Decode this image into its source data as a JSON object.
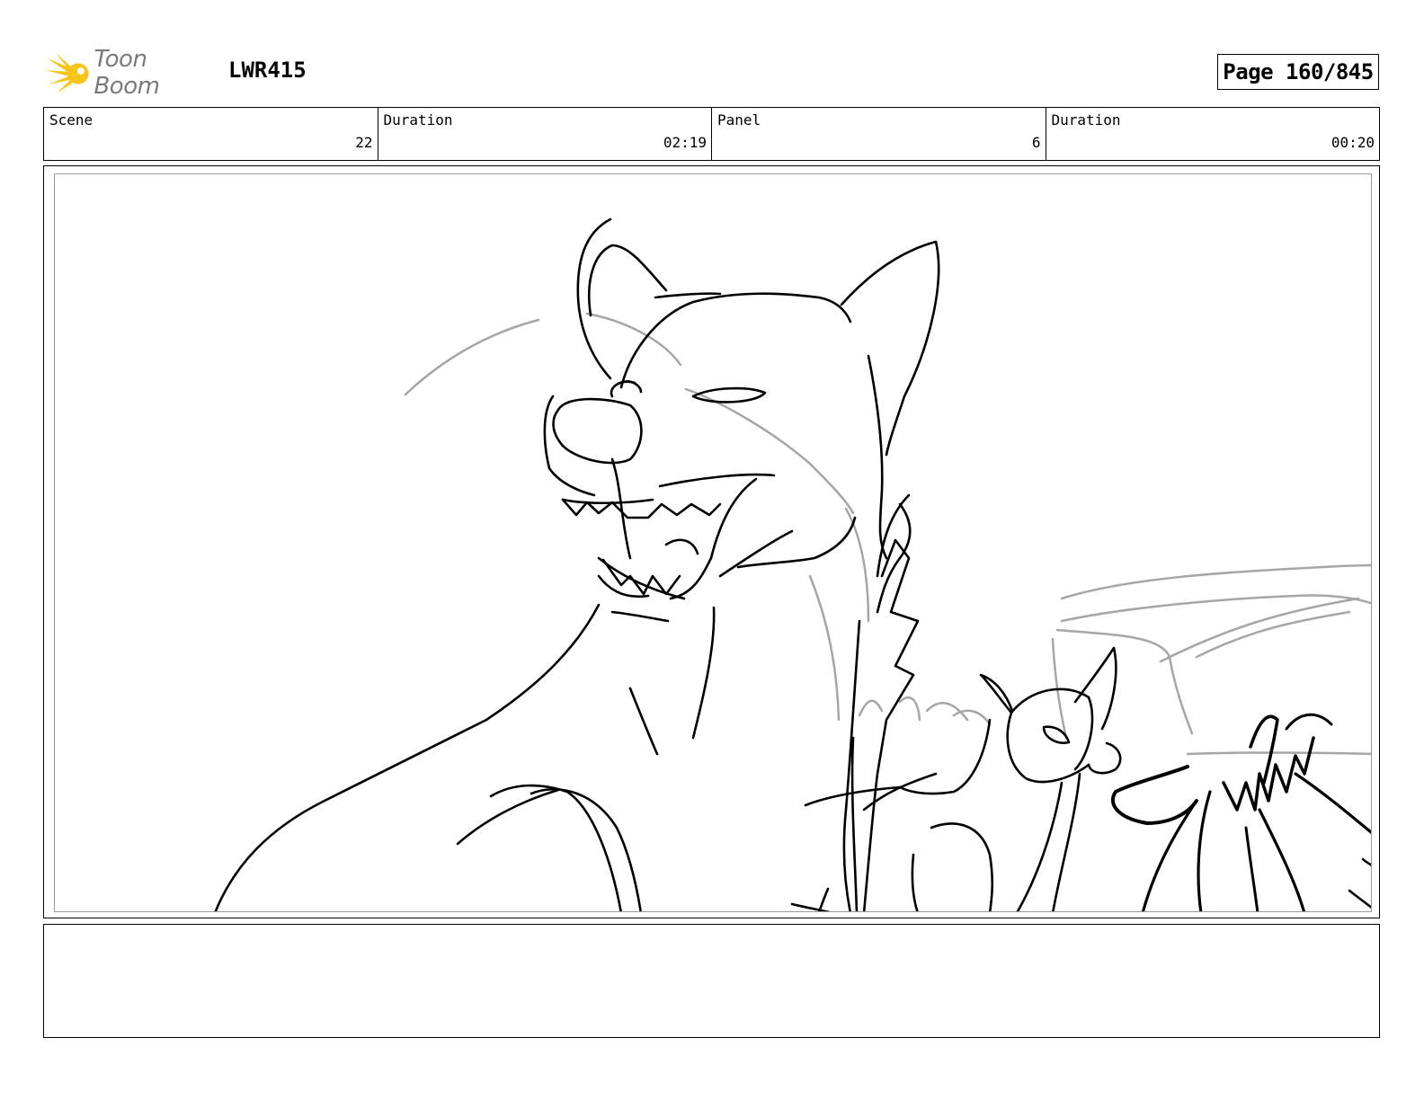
{
  "header": {
    "brand": "Toon Boom",
    "project_code": "LWR415",
    "page_label": "Page 160/845"
  },
  "info": {
    "scene_label": "Scene",
    "scene_value": "22",
    "scene_duration_label": "Duration",
    "scene_duration_value": "02:19",
    "panel_label": "Panel",
    "panel_value": "6",
    "panel_duration_label": "Duration",
    "panel_duration_value": "00:20"
  },
  "notes": {
    "text": ""
  },
  "colors": {
    "logo_yellow": "#f5c518",
    "logo_text": "#7a7a7a",
    "sketch_line": "#000000",
    "sketch_rough": "#a6a6a6"
  },
  "icons": {
    "logo": "toon-boom-starburst-icon"
  }
}
